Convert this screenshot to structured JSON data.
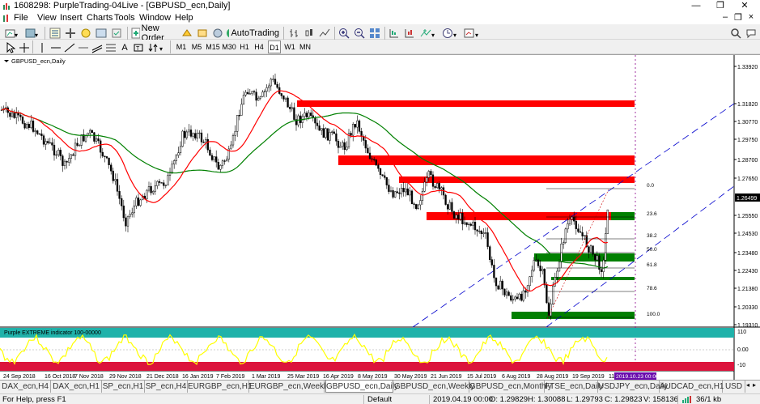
{
  "window": {
    "title": "1608298: PurpleTrading-04Live - [GBPUSD_ecn,Daily]",
    "min": "—",
    "restore": "❐",
    "close": "✕"
  },
  "menu": {
    "items": [
      "File",
      "View",
      "Insert",
      "Charts",
      "Tools",
      "Window",
      "Help"
    ],
    "doc_min": "–",
    "doc_restore": "❐",
    "doc_close": "×"
  },
  "toolbar": {
    "new_order": "New Order",
    "autotrading": "AutoTrading"
  },
  "timeframes": [
    "M1",
    "M5",
    "M15",
    "M30",
    "H1",
    "H4",
    "D1",
    "W1",
    "MN"
  ],
  "chart": {
    "symbol_label": "GBPUSD_ecn,Daily",
    "indicator_label": "Purple EXTREME indicator 100-00000",
    "current_price": "1.26499",
    "price_ticks": [
      "1.33920",
      "1.31820",
      "1.30770",
      "1.29750",
      "1.28700",
      "1.27650",
      "1.26499",
      "1.25550",
      "1.24530",
      "1.23480",
      "1.22430",
      "1.21380",
      "1.20330",
      "1.19310"
    ],
    "indicator_ticks": [
      "110",
      "0.00",
      "-10"
    ],
    "fib_levels": [
      "0.0",
      "23.6",
      "38.2",
      "50.0",
      "61.8",
      "78.6",
      "100.0"
    ],
    "date_ticks": [
      "24 Sep 2018",
      "16 Oct 2018",
      "7 Nov 2018",
      "29 Nov 2018",
      "21 Dec 2018",
      "16 Jan 2019",
      "7 Feb 2019",
      "1 Mar 2019",
      "25 Mar 2019",
      "16 Apr 2019",
      "8 May 2019",
      "30 May 2019",
      "21 Jun 2019",
      "15 Jul 2019",
      "6 Aug 2019",
      "28 Aug 2019",
      "19 Sep 2019",
      "11"
    ],
    "crosshair_date": "2019.10.23 00:00",
    "colors": {
      "resistance": "#ff0000",
      "support": "#008000",
      "ma_fast": "#ff0000",
      "ma_slow": "#008000",
      "indicator": "#ffff00",
      "indicator_bg": "#ffffff",
      "zone_top": "#20b2aa",
      "zone_bottom": "#dc143c"
    }
  },
  "tabs": [
    "DAX_ecn,H4",
    "DAX_ecn,H1",
    "SP_ecn,H1",
    "SP_ecn,H4",
    "EURGBP_ecn,H1",
    "EURGBP_ecn,Weekly",
    "GBPUSD_ecn,Daily",
    "GBPUSD_ecn,Weekly",
    "GBPUSD_ecn,Monthly",
    "FTSE_ecn,Daily",
    "USDJPY_ecn,Daily",
    "AUDCAD_ecn,H1",
    "USD"
  ],
  "status": {
    "help": "For Help, press F1",
    "profile": "Default",
    "datetime": "2019.04.19 00:00",
    "open": "O: 1.29829",
    "high": "H: 1.30088",
    "low": "L: 1.29793",
    "close": "C: 1.29823",
    "volume": "V: 158136",
    "traffic": "36/1 kb"
  }
}
